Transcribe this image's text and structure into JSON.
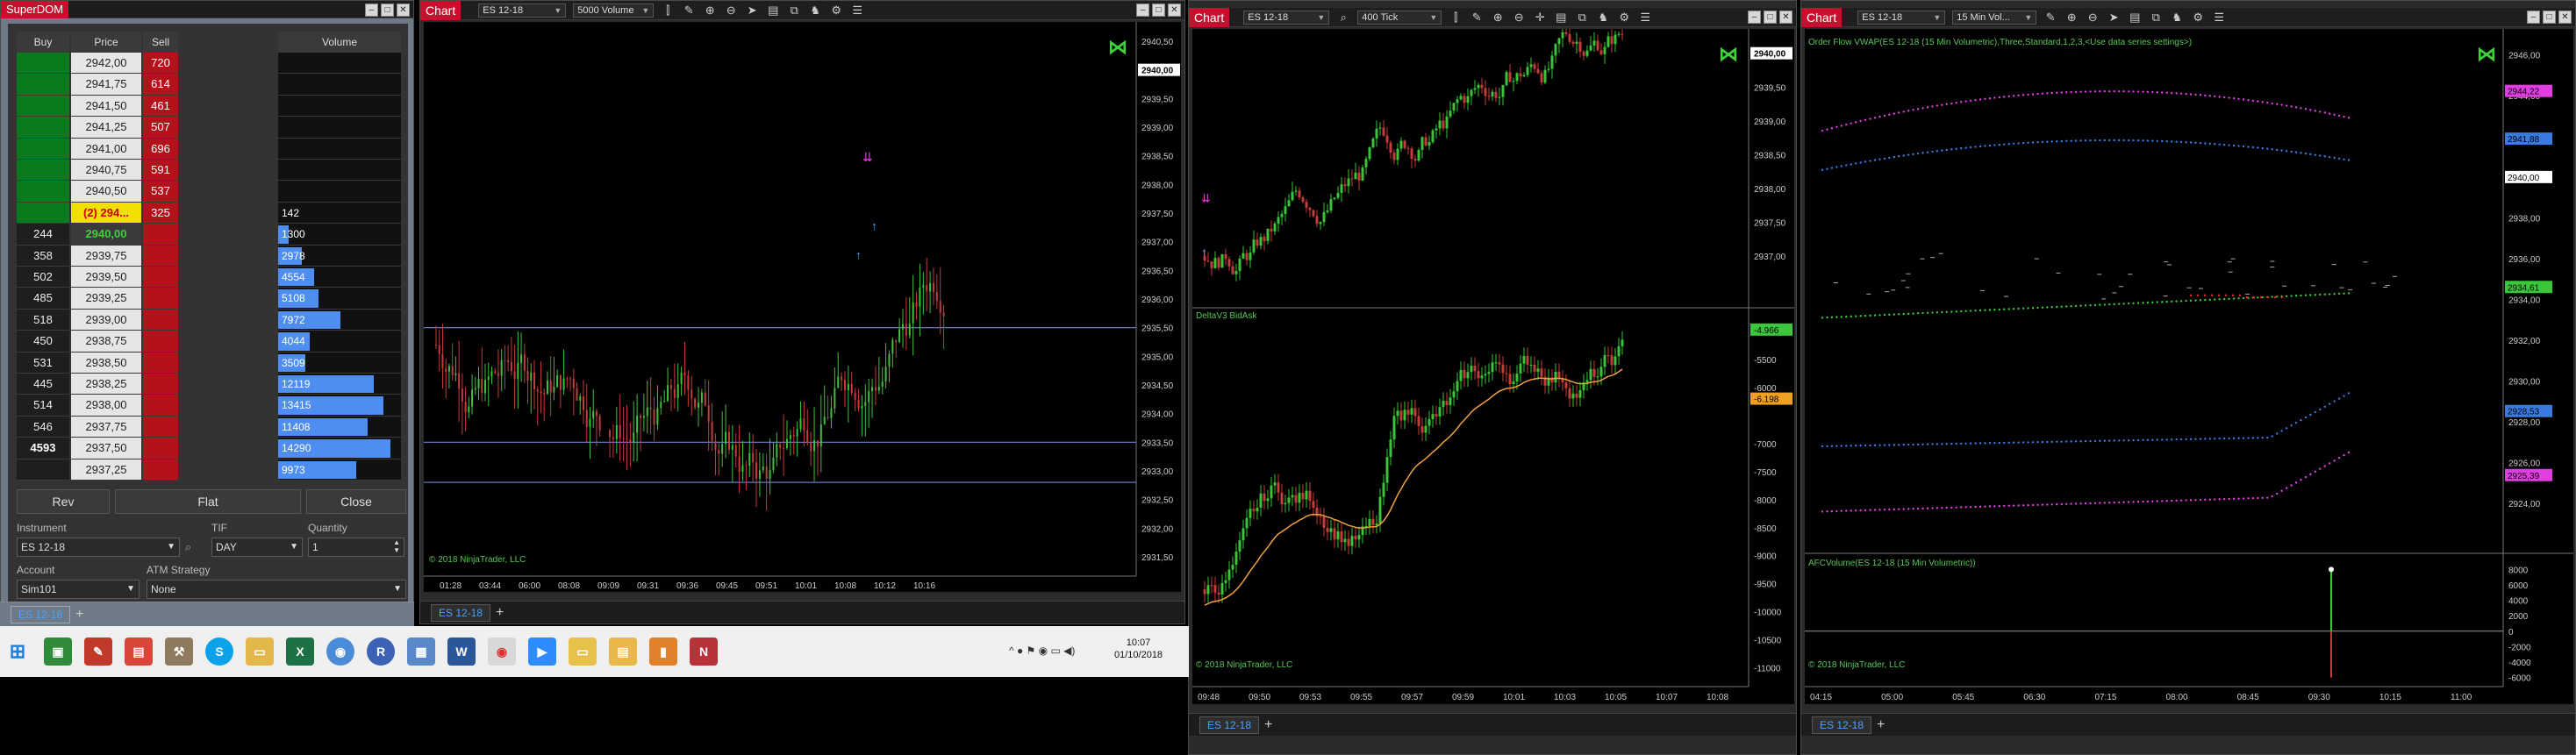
{
  "superdom": {
    "title": "SuperDOM",
    "headers": {
      "buy": "Buy",
      "price": "Price",
      "sell": "Sell",
      "volume": "Volume"
    },
    "rows": [
      {
        "buy": "",
        "price": "2942,00",
        "sell": "720",
        "vol": ""
      },
      {
        "buy": "",
        "price": "2941,75",
        "sell": "614",
        "vol": ""
      },
      {
        "buy": "",
        "price": "2941,50",
        "sell": "461",
        "vol": ""
      },
      {
        "buy": "",
        "price": "2941,25",
        "sell": "507",
        "vol": ""
      },
      {
        "buy": "",
        "price": "2941,00",
        "sell": "696",
        "vol": ""
      },
      {
        "buy": "",
        "price": "2940,75",
        "sell": "591",
        "vol": ""
      },
      {
        "buy": "",
        "price": "2940,50",
        "sell": "537",
        "vol": ""
      },
      {
        "buy": "",
        "price": "(2) 294...",
        "sell": "325",
        "vol": "142"
      },
      {
        "buy": "244",
        "price": "2940,00",
        "sell": "",
        "vol": "1300"
      },
      {
        "buy": "358",
        "price": "2939,75",
        "sell": "",
        "vol": "2978"
      },
      {
        "buy": "502",
        "price": "2939,50",
        "sell": "",
        "vol": "4554"
      },
      {
        "buy": "485",
        "price": "2939,25",
        "sell": "",
        "vol": "5108"
      },
      {
        "buy": "518",
        "price": "2939,00",
        "sell": "",
        "vol": "7972"
      },
      {
        "buy": "450",
        "price": "2938,75",
        "sell": "",
        "vol": "4044"
      },
      {
        "buy": "531",
        "price": "2938,50",
        "sell": "",
        "vol": "3509"
      },
      {
        "buy": "445",
        "price": "2938,25",
        "sell": "",
        "vol": "12119"
      },
      {
        "buy": "514",
        "price": "2938,00",
        "sell": "",
        "vol": "13415"
      },
      {
        "buy": "546",
        "price": "2937,75",
        "sell": "",
        "vol": "11408"
      },
      {
        "buy": "4593",
        "price": "2937,50",
        "sell": "",
        "vol": "14290"
      },
      {
        "buy": "",
        "price": "2937,25",
        "sell": "",
        "vol": "9973"
      }
    ],
    "buttons": {
      "rev": "Rev",
      "flat": "Flat",
      "close": "Close"
    },
    "fields": {
      "instrument_label": "Instrument",
      "instrument": "ES 12-18",
      "tif_label": "TIF",
      "tif": "DAY",
      "quantity_label": "Quantity",
      "quantity": "1",
      "account_label": "Account",
      "account": "Sim101",
      "atm_label": "ATM Strategy",
      "atm": "None"
    },
    "tab": "ES 12-18"
  },
  "chart1": {
    "apptag": "Chart",
    "instrument": "ES 12-18",
    "period": "5000 Volume",
    "copyright": "© 2018 NinjaTrader, LLC",
    "yticks": [
      "2940,00",
      "2939,50",
      "2939,00",
      "2938,50",
      "2938,00",
      "2937,50",
      "2937,00",
      "2936,50",
      "2936,00",
      "2935,50",
      "2935,00",
      "2934,50",
      "2934,00",
      "2933,50",
      "2933,00",
      "2932,50",
      "2932,00",
      "2931,50"
    ],
    "ytop": "2940,50",
    "xticks": [
      "01:28",
      "03:44",
      "06:00",
      "08:08",
      "09:09",
      "09:31",
      "09:36",
      "09:45",
      "09:51",
      "10:01",
      "10:08",
      "10:12",
      "10:16"
    ],
    "last_price": "2940,00",
    "tab": "ES 12-18"
  },
  "chart2": {
    "apptag": "Chart",
    "instrument": "ES 12-18",
    "period": "400 Tick",
    "yticks_top": [
      "2939,50",
      "2939,00",
      "2938,50",
      "2938,00",
      "2937,50",
      "2937,00"
    ],
    "last_price": "2940,00",
    "indicator": "DeltaV3 BidAsk",
    "yticks_bottom": [
      "-5500",
      "-6000",
      "-7000",
      "-7500",
      "-8000",
      "-8500",
      "-9000",
      "-9500",
      "-10000",
      "-10500",
      "-11000"
    ],
    "delta_tag": "-4.966",
    "delta_tag2": "-6.198",
    "xticks": [
      "09:48",
      "09:50",
      "09:53",
      "09:55",
      "09:57",
      "09:59",
      "10:01",
      "10:03",
      "10:05",
      "10:07",
      "10:08"
    ],
    "copyright": "© 2018 NinjaTrader, LLC",
    "tab": "ES 12-18"
  },
  "chart3": {
    "apptag": "Chart",
    "instrument": "ES 12-18",
    "period": "15 Min Vol...",
    "indicator": "Order Flow VWAP(ES 12-18 (15 Min Volumetric),Three,Standard,1,2,3,<Use data series settings>)",
    "yticks": [
      "2946,00",
      "2944,00",
      "2942,00",
      "2940,00",
      "2938,00",
      "2936,00",
      "2934,00",
      "2932,00",
      "2930,00",
      "2928,00",
      "2926,00",
      "2924,00"
    ],
    "tags": [
      {
        "label": "2944,22",
        "color": "#e13ee1"
      },
      {
        "label": "2941,88",
        "color": "#3a7be0"
      },
      {
        "label": "2940,00",
        "color": "#ffffff"
      },
      {
        "label": "2934,61",
        "color": "#3cc63c"
      },
      {
        "label": "2928,53",
        "color": "#3a7be0"
      },
      {
        "label": "2925,39",
        "color": "#e13ee1"
      }
    ],
    "volume_indicator": "AFCVolume(ES 12-18 (15 Min Volumetric))",
    "vol_ticks": [
      "8000",
      "6000",
      "4000",
      "2000",
      "0",
      "-2000",
      "-4000",
      "-6000"
    ],
    "xticks": [
      "04:15",
      "05:00",
      "05:45",
      "06:30",
      "07:15",
      "08:00",
      "08:45",
      "09:30",
      "10:15",
      "11:00"
    ],
    "copyright": "© 2018 NinjaTrader, LLC",
    "tab": "ES 12-18"
  },
  "taskbar": {
    "clock_time": "10:07",
    "clock_date": "01/10/2018"
  },
  "colors": {
    "bid": "#0b7a1f",
    "ask": "#b3121b",
    "candle_up": "#3dc23d",
    "candle_down": "#c23d3d",
    "volbar": "#4d8ef0",
    "accent": "#c8102e"
  }
}
